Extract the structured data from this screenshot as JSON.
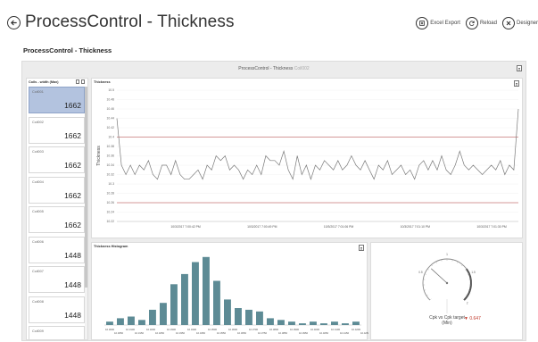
{
  "app": {
    "title": "ProcessControl - Thickness",
    "actions": [
      {
        "label": "Excel Export",
        "icon": "excel-export-icon"
      },
      {
        "label": "Reload",
        "icon": "reload-icon"
      },
      {
        "label": "Designer",
        "icon": "designer-icon"
      }
    ]
  },
  "page": {
    "subtitle": "ProcessControl - Thickness"
  },
  "dashboard": {
    "title": "ProcessControl - Thickness",
    "title_suffix": "Coil002"
  },
  "coil_list": {
    "header": "Coils - width (Max)",
    "items": [
      {
        "id": "Coil001",
        "value": "1662",
        "selected": true
      },
      {
        "id": "Coil002",
        "value": "1662",
        "selected": false
      },
      {
        "id": "Coil003",
        "value": "1662",
        "selected": false
      },
      {
        "id": "Coil004",
        "value": "1662",
        "selected": false
      },
      {
        "id": "Coil005",
        "value": "1662",
        "selected": false
      },
      {
        "id": "Coil006",
        "value": "1448",
        "selected": false
      },
      {
        "id": "Coil007",
        "value": "1448",
        "selected": false
      },
      {
        "id": "Coil008",
        "value": "1448",
        "selected": false
      },
      {
        "id": "Coil009",
        "value": "",
        "selected": false
      }
    ]
  },
  "thickness_panel": {
    "title": "Thickness"
  },
  "histogram_panel": {
    "title": "Thickness Histogram"
  },
  "gauge_panel": {
    "label": "Cpk vs Cpk target (Min)",
    "value": "0.647",
    "value_color": "#c0392b"
  },
  "colors": {
    "selected_card": "#b3c3df",
    "line": "#7a7a7a",
    "limit_line": "#c97a7a",
    "bar": "#5d8b95"
  },
  "chart_data": [
    {
      "type": "line",
      "title": "",
      "xlabel": "",
      "ylabel": "Thickness",
      "ylim": [
        10.22,
        10.5
      ],
      "yticks": [
        10.22,
        10.24,
        10.26,
        10.28,
        10.3,
        10.32,
        10.34,
        10.36,
        10.38,
        10.4,
        10.42,
        10.44,
        10.46,
        10.48,
        10.5
      ],
      "xtick_labels": [
        "10/3/2017 7:00:42 PM",
        "10/3/2017 7:00:49 PM",
        "10/3/2017 7:01:06 PM",
        "10/3/2017 7:01:10 PM",
        "10/3/2017 7:01:30 PM"
      ],
      "limits": {
        "upper": 10.4,
        "lower": 10.26
      },
      "series": [
        {
          "values": [
            10.44,
            10.34,
            10.32,
            10.34,
            10.32,
            10.34,
            10.33,
            10.35,
            10.32,
            10.31,
            10.34,
            10.34,
            10.32,
            10.35,
            10.32,
            10.31,
            10.31,
            10.32,
            10.33,
            10.31,
            10.34,
            10.33,
            10.36,
            10.35,
            10.36,
            10.33,
            10.34,
            10.33,
            10.31,
            10.33,
            10.32,
            10.34,
            10.32,
            10.36,
            10.35,
            10.35,
            10.34,
            10.37,
            10.33,
            10.31,
            10.36,
            10.32,
            10.34,
            10.31,
            10.34,
            10.33,
            10.35,
            10.34,
            10.33,
            10.35,
            10.33,
            10.34,
            10.36,
            10.34,
            10.33,
            10.35,
            10.33,
            10.31,
            10.34,
            10.33,
            10.35,
            10.32,
            10.33,
            10.34,
            10.32,
            10.33,
            10.31,
            10.34,
            10.35,
            10.33,
            10.35,
            10.33,
            10.36,
            10.33,
            10.32,
            10.34,
            10.37,
            10.34,
            10.33,
            10.34,
            10.33,
            10.32,
            10.33,
            10.34,
            10.33,
            10.35,
            10.32,
            10.34,
            10.33,
            10.46
          ]
        }
      ]
    },
    {
      "type": "bar",
      "title": "",
      "xlabel": "",
      "ylabel": "",
      "categories": [
        "10.3000",
        "10.3100",
        "10.3200",
        "10.3300",
        "10.3400",
        "10.3500",
        "10.3600",
        "10.3700",
        "10.3800",
        "10.3900",
        "10.4000",
        "10.4100",
        "10.4200"
      ],
      "category_labels_top": [
        "10.3000",
        "10.3100",
        "10.3200",
        "10.3300",
        "10.3400",
        "10.3500",
        "10.3600",
        "10.3700",
        "10.3800",
        "10.3900",
        "10.4000",
        "10.4100",
        "10.4200"
      ],
      "category_labels_bottom": [
        "10.3050",
        "10.3150",
        "10.3250",
        "10.3350",
        "10.3450",
        "10.3550",
        "10.3650",
        "10.3750",
        "10.3850",
        "10.3950",
        "10.4050",
        "10.4150",
        "10.4250"
      ],
      "values": [
        2,
        4,
        5,
        3,
        9,
        13,
        24,
        30,
        37,
        40,
        26,
        15,
        10,
        9,
        8,
        4,
        3,
        2,
        1,
        2,
        1,
        2,
        1,
        2
      ],
      "ylim": [
        0,
        42
      ]
    },
    {
      "type": "gauge",
      "tick_labels": [
        "0.5",
        "1",
        "1.5",
        "2"
      ],
      "min": 0,
      "max": 2,
      "value": 0.647
    }
  ]
}
